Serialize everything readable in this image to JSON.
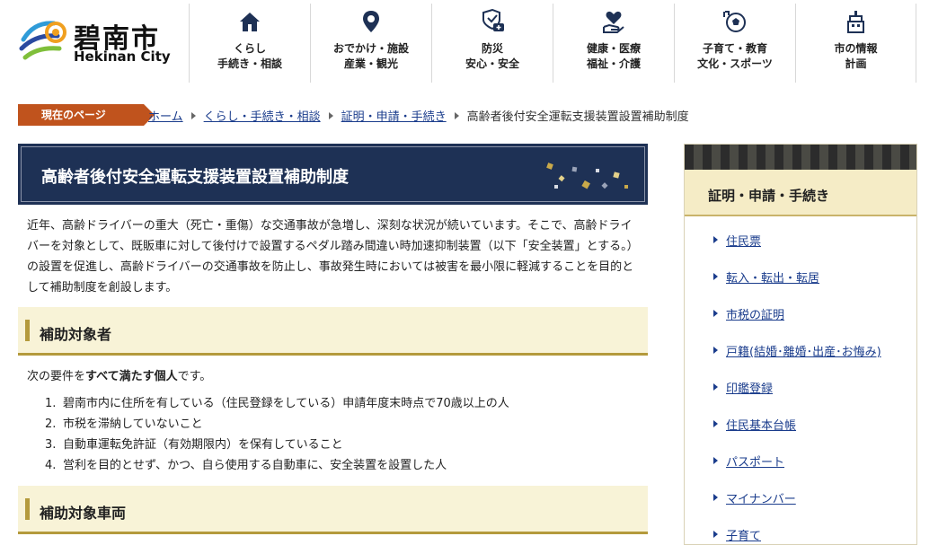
{
  "logo": {
    "name_jp": "碧南市",
    "name_en": "Hekinan City"
  },
  "gnav": [
    {
      "icon": "house-icon",
      "line1": "くらし",
      "line2": "手続き・相談"
    },
    {
      "icon": "map-pin-icon",
      "line1": "おでかけ・施設",
      "line2": "産業・観光"
    },
    {
      "icon": "shield-ambulance-icon",
      "line1": "防災",
      "line2": "安心・安全"
    },
    {
      "icon": "heart-hand-icon",
      "line1": "健康・医療",
      "line2": "福祉・介護"
    },
    {
      "icon": "soccer-ball-icon",
      "line1": "子育て・教育",
      "line2": "文化・スポーツ"
    },
    {
      "icon": "city-hall-icon",
      "line1": "市の情報",
      "line2": "計画"
    }
  ],
  "breadcrumb": {
    "tag": "現在のページ",
    "items": [
      "ホーム",
      "くらし・手続き・相談",
      "証明・申請・手続き"
    ],
    "current": "高齢者後付安全運転支援装置設置補助制度"
  },
  "page_title": "高齢者後付安全運転支援装置設置補助制度",
  "intro": "近年、高齢ドライバーの重大（死亡・重傷）な交通事故が急増し、深刻な状況が続いています。そこで、高齢ドライバーを対象として、既販車に対して後付けで設置するペダル踏み間違い時加速抑制装置（以下「安全装置」とする。）の設置を促進し、高齢ドライバーの交通事故を防止し、事故発生時においては被害を最小限に軽減することを目的として補助制度を創設します。",
  "section1": {
    "heading": "補助対象者",
    "lead_pre": "次の要件を",
    "lead_bold": "すべて満たす個人",
    "lead_post": "です。",
    "items": [
      "碧南市内に住所を有している（住民登録をしている）申請年度末時点で70歳以上の人",
      "市税を滞納していないこと",
      "自動車運転免許証（有効期限内）を保有していること",
      "営利を目的とせず、かつ、自ら使用する自動車に、安全装置を設置した人"
    ]
  },
  "section2": {
    "heading": "補助対象車両"
  },
  "sidebar": {
    "heading": "証明・申請・手続き",
    "links": [
      "住民票",
      "転入・転出・転居",
      "市税の証明",
      "戸籍(結婚･離婚･出産･お悔み)",
      "印鑑登録",
      "住民基本台帳",
      "パスポート",
      "マイナンバー",
      "子育て"
    ]
  },
  "colors": {
    "navy": "#1e3155",
    "gold": "#b49a3c",
    "orange": "#c0531d",
    "link": "#1a3c8c"
  }
}
